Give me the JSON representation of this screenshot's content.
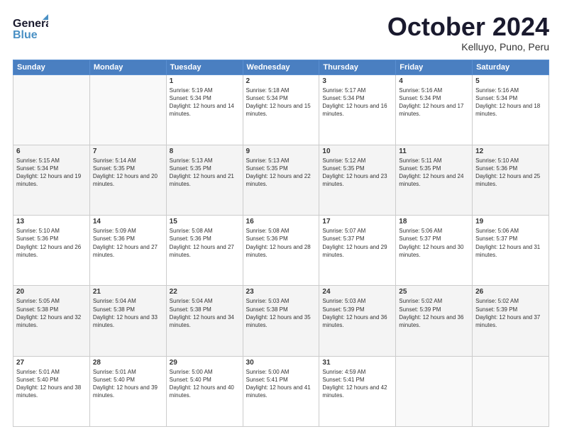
{
  "header": {
    "logo": {
      "general": "General",
      "blue": "Blue"
    },
    "title": "October 2024",
    "location": "Kelluyo, Puno, Peru"
  },
  "weekdays": [
    "Sunday",
    "Monday",
    "Tuesday",
    "Wednesday",
    "Thursday",
    "Friday",
    "Saturday"
  ],
  "weeks": [
    [
      {
        "day": null
      },
      {
        "day": null
      },
      {
        "day": "1",
        "sunrise": "Sunrise: 5:19 AM",
        "sunset": "Sunset: 5:34 PM",
        "daylight": "Daylight: 12 hours and 14 minutes."
      },
      {
        "day": "2",
        "sunrise": "Sunrise: 5:18 AM",
        "sunset": "Sunset: 5:34 PM",
        "daylight": "Daylight: 12 hours and 15 minutes."
      },
      {
        "day": "3",
        "sunrise": "Sunrise: 5:17 AM",
        "sunset": "Sunset: 5:34 PM",
        "daylight": "Daylight: 12 hours and 16 minutes."
      },
      {
        "day": "4",
        "sunrise": "Sunrise: 5:16 AM",
        "sunset": "Sunset: 5:34 PM",
        "daylight": "Daylight: 12 hours and 17 minutes."
      },
      {
        "day": "5",
        "sunrise": "Sunrise: 5:16 AM",
        "sunset": "Sunset: 5:34 PM",
        "daylight": "Daylight: 12 hours and 18 minutes."
      }
    ],
    [
      {
        "day": "6",
        "sunrise": "Sunrise: 5:15 AM",
        "sunset": "Sunset: 5:34 PM",
        "daylight": "Daylight: 12 hours and 19 minutes."
      },
      {
        "day": "7",
        "sunrise": "Sunrise: 5:14 AM",
        "sunset": "Sunset: 5:35 PM",
        "daylight": "Daylight: 12 hours and 20 minutes."
      },
      {
        "day": "8",
        "sunrise": "Sunrise: 5:13 AM",
        "sunset": "Sunset: 5:35 PM",
        "daylight": "Daylight: 12 hours and 21 minutes."
      },
      {
        "day": "9",
        "sunrise": "Sunrise: 5:13 AM",
        "sunset": "Sunset: 5:35 PM",
        "daylight": "Daylight: 12 hours and 22 minutes."
      },
      {
        "day": "10",
        "sunrise": "Sunrise: 5:12 AM",
        "sunset": "Sunset: 5:35 PM",
        "daylight": "Daylight: 12 hours and 23 minutes."
      },
      {
        "day": "11",
        "sunrise": "Sunrise: 5:11 AM",
        "sunset": "Sunset: 5:35 PM",
        "daylight": "Daylight: 12 hours and 24 minutes."
      },
      {
        "day": "12",
        "sunrise": "Sunrise: 5:10 AM",
        "sunset": "Sunset: 5:36 PM",
        "daylight": "Daylight: 12 hours and 25 minutes."
      }
    ],
    [
      {
        "day": "13",
        "sunrise": "Sunrise: 5:10 AM",
        "sunset": "Sunset: 5:36 PM",
        "daylight": "Daylight: 12 hours and 26 minutes."
      },
      {
        "day": "14",
        "sunrise": "Sunrise: 5:09 AM",
        "sunset": "Sunset: 5:36 PM",
        "daylight": "Daylight: 12 hours and 27 minutes."
      },
      {
        "day": "15",
        "sunrise": "Sunrise: 5:08 AM",
        "sunset": "Sunset: 5:36 PM",
        "daylight": "Daylight: 12 hours and 27 minutes."
      },
      {
        "day": "16",
        "sunrise": "Sunrise: 5:08 AM",
        "sunset": "Sunset: 5:36 PM",
        "daylight": "Daylight: 12 hours and 28 minutes."
      },
      {
        "day": "17",
        "sunrise": "Sunrise: 5:07 AM",
        "sunset": "Sunset: 5:37 PM",
        "daylight": "Daylight: 12 hours and 29 minutes."
      },
      {
        "day": "18",
        "sunrise": "Sunrise: 5:06 AM",
        "sunset": "Sunset: 5:37 PM",
        "daylight": "Daylight: 12 hours and 30 minutes."
      },
      {
        "day": "19",
        "sunrise": "Sunrise: 5:06 AM",
        "sunset": "Sunset: 5:37 PM",
        "daylight": "Daylight: 12 hours and 31 minutes."
      }
    ],
    [
      {
        "day": "20",
        "sunrise": "Sunrise: 5:05 AM",
        "sunset": "Sunset: 5:38 PM",
        "daylight": "Daylight: 12 hours and 32 minutes."
      },
      {
        "day": "21",
        "sunrise": "Sunrise: 5:04 AM",
        "sunset": "Sunset: 5:38 PM",
        "daylight": "Daylight: 12 hours and 33 minutes."
      },
      {
        "day": "22",
        "sunrise": "Sunrise: 5:04 AM",
        "sunset": "Sunset: 5:38 PM",
        "daylight": "Daylight: 12 hours and 34 minutes."
      },
      {
        "day": "23",
        "sunrise": "Sunrise: 5:03 AM",
        "sunset": "Sunset: 5:38 PM",
        "daylight": "Daylight: 12 hours and 35 minutes."
      },
      {
        "day": "24",
        "sunrise": "Sunrise: 5:03 AM",
        "sunset": "Sunset: 5:39 PM",
        "daylight": "Daylight: 12 hours and 36 minutes."
      },
      {
        "day": "25",
        "sunrise": "Sunrise: 5:02 AM",
        "sunset": "Sunset: 5:39 PM",
        "daylight": "Daylight: 12 hours and 36 minutes."
      },
      {
        "day": "26",
        "sunrise": "Sunrise: 5:02 AM",
        "sunset": "Sunset: 5:39 PM",
        "daylight": "Daylight: 12 hours and 37 minutes."
      }
    ],
    [
      {
        "day": "27",
        "sunrise": "Sunrise: 5:01 AM",
        "sunset": "Sunset: 5:40 PM",
        "daylight": "Daylight: 12 hours and 38 minutes."
      },
      {
        "day": "28",
        "sunrise": "Sunrise: 5:01 AM",
        "sunset": "Sunset: 5:40 PM",
        "daylight": "Daylight: 12 hours and 39 minutes."
      },
      {
        "day": "29",
        "sunrise": "Sunrise: 5:00 AM",
        "sunset": "Sunset: 5:40 PM",
        "daylight": "Daylight: 12 hours and 40 minutes."
      },
      {
        "day": "30",
        "sunrise": "Sunrise: 5:00 AM",
        "sunset": "Sunset: 5:41 PM",
        "daylight": "Daylight: 12 hours and 41 minutes."
      },
      {
        "day": "31",
        "sunrise": "Sunrise: 4:59 AM",
        "sunset": "Sunset: 5:41 PM",
        "daylight": "Daylight: 12 hours and 42 minutes."
      },
      {
        "day": null
      },
      {
        "day": null
      }
    ]
  ]
}
